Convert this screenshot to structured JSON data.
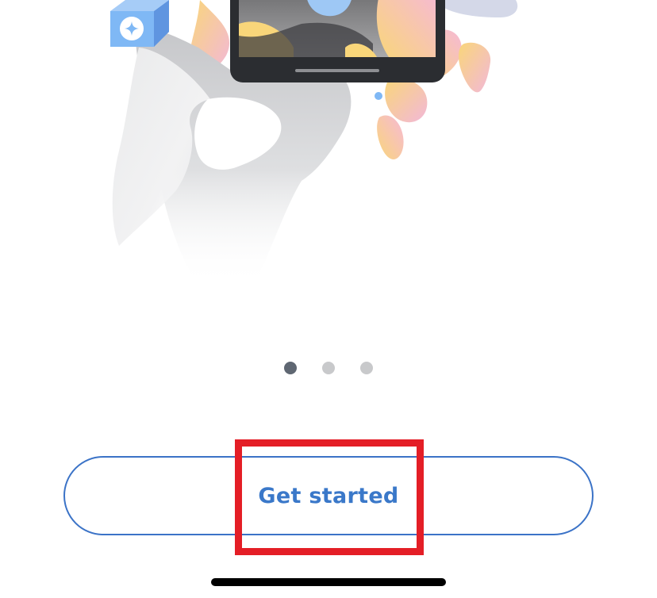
{
  "onboarding": {
    "illustration": {
      "subject": "hand-holding-phone",
      "badge_icon": "sparkle-icon",
      "colors": {
        "badge": "#7fb8f5",
        "blob_yellow": "#f9d67a",
        "blob_pink": "#f2b8d8",
        "phone_frame": "#2b2d31",
        "hand": "#d2d3d5"
      }
    },
    "pager": {
      "total_pages": 3,
      "current_page": 1,
      "colors": {
        "active": "#5f6772",
        "inactive": "#c8c9cb"
      }
    },
    "cta": {
      "label": "Get started",
      "color": "#3a78c9"
    },
    "annotation": {
      "highlight_color": "#e41e26"
    }
  }
}
